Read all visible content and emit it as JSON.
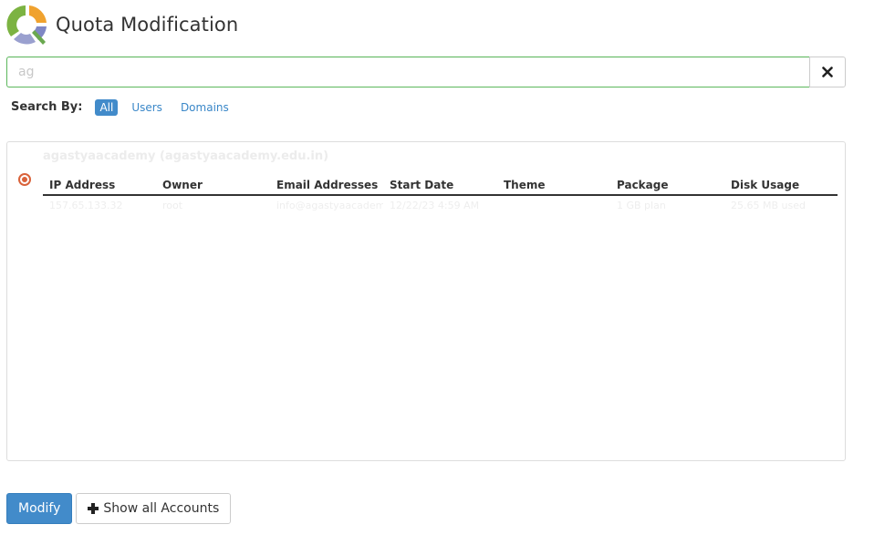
{
  "header": {
    "title": "Quota Modification",
    "icon": "quota-pie-icon"
  },
  "search": {
    "value": "ag"
  },
  "search_by": {
    "label": "Search By:",
    "options": [
      "All",
      "Users",
      "Domains"
    ],
    "selected": "All"
  },
  "results": {
    "account": {
      "title": "agastyaacademy (agastyaacademy.edu.in)",
      "selected": true
    },
    "columns": [
      "IP Address",
      "Owner",
      "Email Addresses",
      "Start Date",
      "Theme",
      "Package",
      "Disk Usage"
    ],
    "row": [
      "157.65.133.32",
      "root",
      "info@agastyaacademy.edu.in",
      "12/22/23 4:59 AM",
      "",
      "1 GB plan",
      "25.65 MB used"
    ]
  },
  "buttons": {
    "modify": "Modify",
    "show_all": "Show all Accounts"
  },
  "colors": {
    "primary": "#428bca",
    "input_focus_border": "#5cb85c",
    "radio": "#d9623a"
  }
}
